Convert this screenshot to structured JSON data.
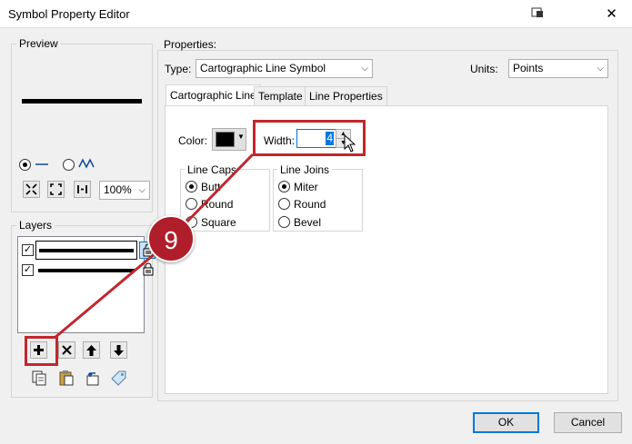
{
  "window": {
    "title": "Symbol Property Editor"
  },
  "preview": {
    "label": "Preview",
    "zoom": "100%"
  },
  "layers": {
    "label": "Layers"
  },
  "properties": {
    "label": "Properties:",
    "type_label": "Type:",
    "type_value": "Cartographic Line Symbol",
    "units_label": "Units:",
    "units_value": "Points"
  },
  "tabs": [
    {
      "label": "Cartographic Line"
    },
    {
      "label": "Template"
    },
    {
      "label": "Line Properties"
    }
  ],
  "cartographic": {
    "color_label": "Color:",
    "color_value": "#000000",
    "width_label": "Width:",
    "width_value": "4",
    "line_caps": {
      "label": "Line Caps",
      "options": [
        "Butt",
        "Round",
        "Square"
      ],
      "selected": "Butt"
    },
    "line_joins": {
      "label": "Line Joins",
      "options": [
        "Miter",
        "Round",
        "Bevel"
      ],
      "selected": "Miter"
    }
  },
  "buttons": {
    "ok": "OK",
    "cancel": "Cancel"
  },
  "annotation": {
    "step_number": "9",
    "color": "#c1272d"
  }
}
